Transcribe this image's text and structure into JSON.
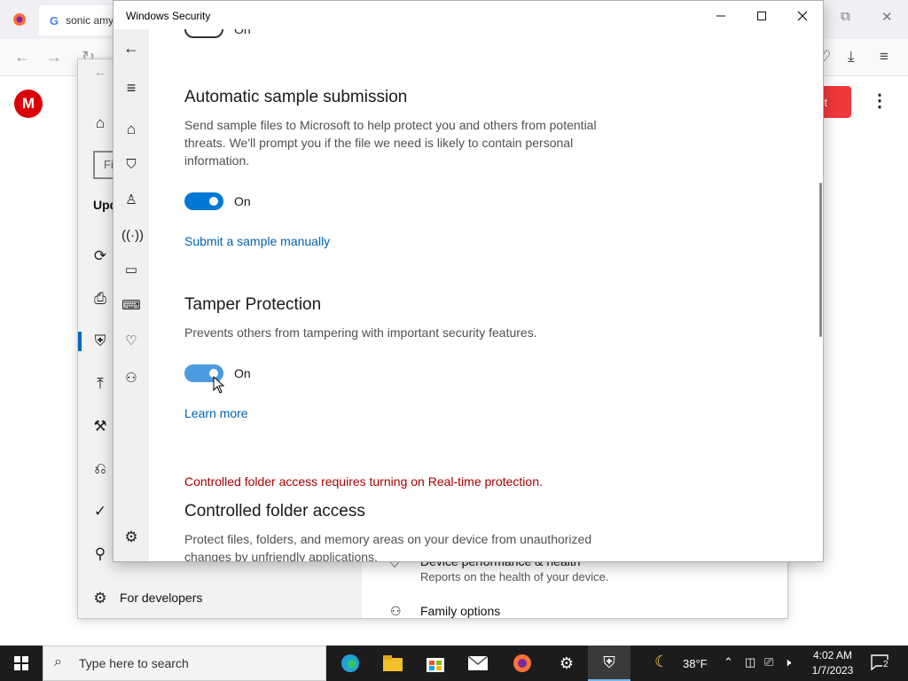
{
  "browser": {
    "tabs": [
      {
        "label": "sonic amy"
      }
    ],
    "google_glyph": "G",
    "mega_logo": "M",
    "mega_button_label": "unt",
    "kebab": "⋮"
  },
  "settings_bg": {
    "find_placeholder": "Fi",
    "section_title": "Upd",
    "for_developers": "For developers",
    "list": {
      "performance_title": "Device performance & health",
      "performance_sub": "Reports on the health of your device.",
      "family_title": "Family options"
    }
  },
  "window": {
    "title": "Windows Security"
  },
  "content": {
    "top_toggle_state": "On",
    "auto_sample": {
      "title": "Automatic sample submission",
      "description": "Send sample files to Microsoft to help protect you and others from potential threats. We'll prompt you if the file we need is likely to contain personal information.",
      "toggle_label": "On",
      "link": "Submit a sample manually"
    },
    "tamper": {
      "title": "Tamper Protection",
      "description": "Prevents others from tampering with important security features.",
      "toggle_label": "On",
      "link": "Learn more"
    },
    "controlled_folder": {
      "warning": "Controlled folder access requires turning on Real-time protection.",
      "title": "Controlled folder access",
      "description": "Protect files, folders, and memory areas on your device from unauthorized changes by unfriendly applications."
    }
  },
  "taskbar": {
    "search_placeholder": "Type here to search",
    "weather": "38°F",
    "time": "4:02 AM",
    "date": "1/7/2023",
    "notifications": "2"
  },
  "colors": {
    "accent": "#0078d4",
    "link": "#0063b1",
    "warning": "#a80000",
    "mega_red": "#d90007"
  }
}
